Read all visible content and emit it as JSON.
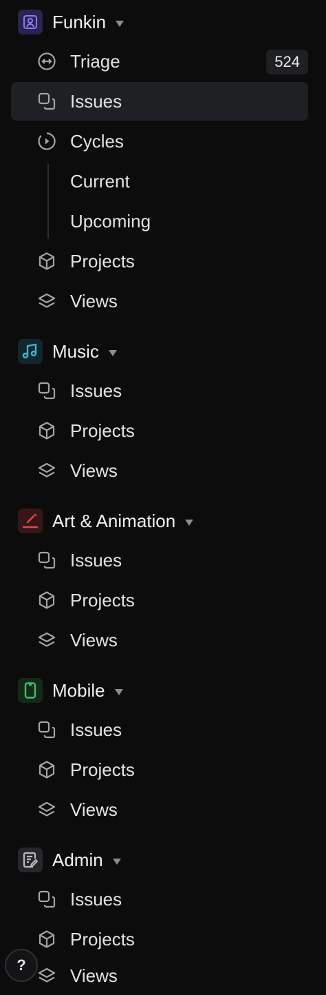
{
  "teams": [
    {
      "name": "Funkin",
      "icon": "user-square-icon",
      "icon_bg": "#2a2450",
      "icon_color": "#8b7cf6",
      "items": [
        {
          "label": "Triage",
          "icon": "triage-icon",
          "badge": "524"
        },
        {
          "label": "Issues",
          "icon": "issues-icon",
          "active": true
        },
        {
          "label": "Cycles",
          "icon": "cycles-icon"
        },
        {
          "label": "Current",
          "icon": "",
          "sub": true
        },
        {
          "label": "Upcoming",
          "icon": "",
          "sub": true
        },
        {
          "label": "Projects",
          "icon": "projects-cube-icon"
        },
        {
          "label": "Views",
          "icon": "views-layers-icon"
        }
      ]
    },
    {
      "name": "Music",
      "icon": "music-note-icon",
      "icon_bg": "#13262d",
      "icon_color": "#3fb5d2",
      "items": [
        {
          "label": "Issues",
          "icon": "issues-icon"
        },
        {
          "label": "Projects",
          "icon": "projects-cube-icon"
        },
        {
          "label": "Views",
          "icon": "views-layers-icon"
        }
      ]
    },
    {
      "name": "Art & Animation",
      "icon": "pen-icon",
      "icon_bg": "#361617",
      "icon_color": "#e5484d",
      "items": [
        {
          "label": "Issues",
          "icon": "issues-icon"
        },
        {
          "label": "Projects",
          "icon": "projects-cube-icon"
        },
        {
          "label": "Views",
          "icon": "views-layers-icon"
        }
      ]
    },
    {
      "name": "Mobile",
      "icon": "phone-icon",
      "icon_bg": "#15291a",
      "icon_color": "#3fbf5f",
      "items": [
        {
          "label": "Issues",
          "icon": "issues-icon"
        },
        {
          "label": "Projects",
          "icon": "projects-cube-icon"
        },
        {
          "label": "Views",
          "icon": "views-layers-icon"
        }
      ]
    },
    {
      "name": "Admin",
      "icon": "document-edit-icon",
      "icon_bg": "#26272b",
      "icon_color": "#b8b8bd",
      "items": [
        {
          "label": "Issues",
          "icon": "issues-icon"
        },
        {
          "label": "Projects",
          "icon": "projects-cube-icon"
        },
        {
          "label": "Views",
          "icon": "views-layers-icon"
        }
      ]
    }
  ],
  "help": {
    "label": "?",
    "icon": "help-icon"
  }
}
